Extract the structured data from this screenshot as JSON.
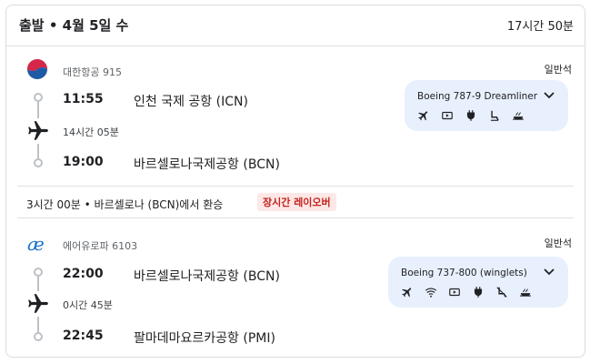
{
  "header": {
    "title": "출발 • 4월 5일 수",
    "total_duration": "17시간 50분"
  },
  "segments": [
    {
      "airline": "대한항공",
      "flight_number": "915",
      "cabin": "일반석",
      "depart_time": "11:55",
      "depart_airport": "인천 국제 공항 (ICN)",
      "duration": "14시간 05분",
      "arrive_time": "19:00",
      "arrive_airport": "바르셀로나국제공항 (BCN)",
      "aircraft": "Boeing 787-9 Dreamliner",
      "amenities": [
        "plane-icon",
        "tv-icon",
        "power-icon",
        "legroom-icon",
        "meal-icon"
      ]
    },
    {
      "airline": "에어유로파",
      "flight_number": "6103",
      "cabin": "일반석",
      "depart_time": "22:00",
      "depart_airport": "바르셀로나국제공항 (BCN)",
      "duration": "0시간 45분",
      "arrive_time": "22:45",
      "arrive_airport": "팔마데마요르카공항 (PMI)",
      "aircraft": "Boeing 737-800 (winglets)",
      "amenities": [
        "plane-icon",
        "wifi-icon",
        "tv-icon",
        "power-icon",
        "no-legroom-icon",
        "meal-icon"
      ]
    }
  ],
  "layover": {
    "text": "3시간 00분 • 바르셀로나 (BCN)에서 환승",
    "badge": "장시간 레이오버"
  },
  "colors": {
    "accent_box": "#e8f0fe",
    "badge_bg": "#fce8e6",
    "badge_text": "#c5221f",
    "timeline": "#bdc1c6"
  }
}
